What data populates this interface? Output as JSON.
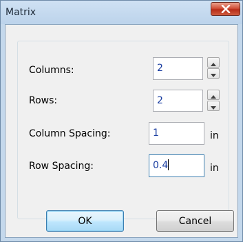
{
  "dialog": {
    "title": "Matrix",
    "close_icon": "close-icon"
  },
  "fields": {
    "columns": {
      "label": "Columns:",
      "value": "2",
      "spinner": true
    },
    "rows": {
      "label": "Rows:",
      "value": "2",
      "spinner": true
    },
    "column_spacing": {
      "label": "Column Spacing:",
      "value": "1",
      "unit": "in"
    },
    "row_spacing": {
      "label": "Row Spacing:",
      "value": "0.4",
      "unit": "in",
      "focused": true
    }
  },
  "buttons": {
    "ok_label": "OK",
    "cancel_label": "Cancel"
  },
  "colors": {
    "close_button": "#c7432c",
    "value_text": "#1a3da0",
    "frame": "#c4d8ec"
  }
}
